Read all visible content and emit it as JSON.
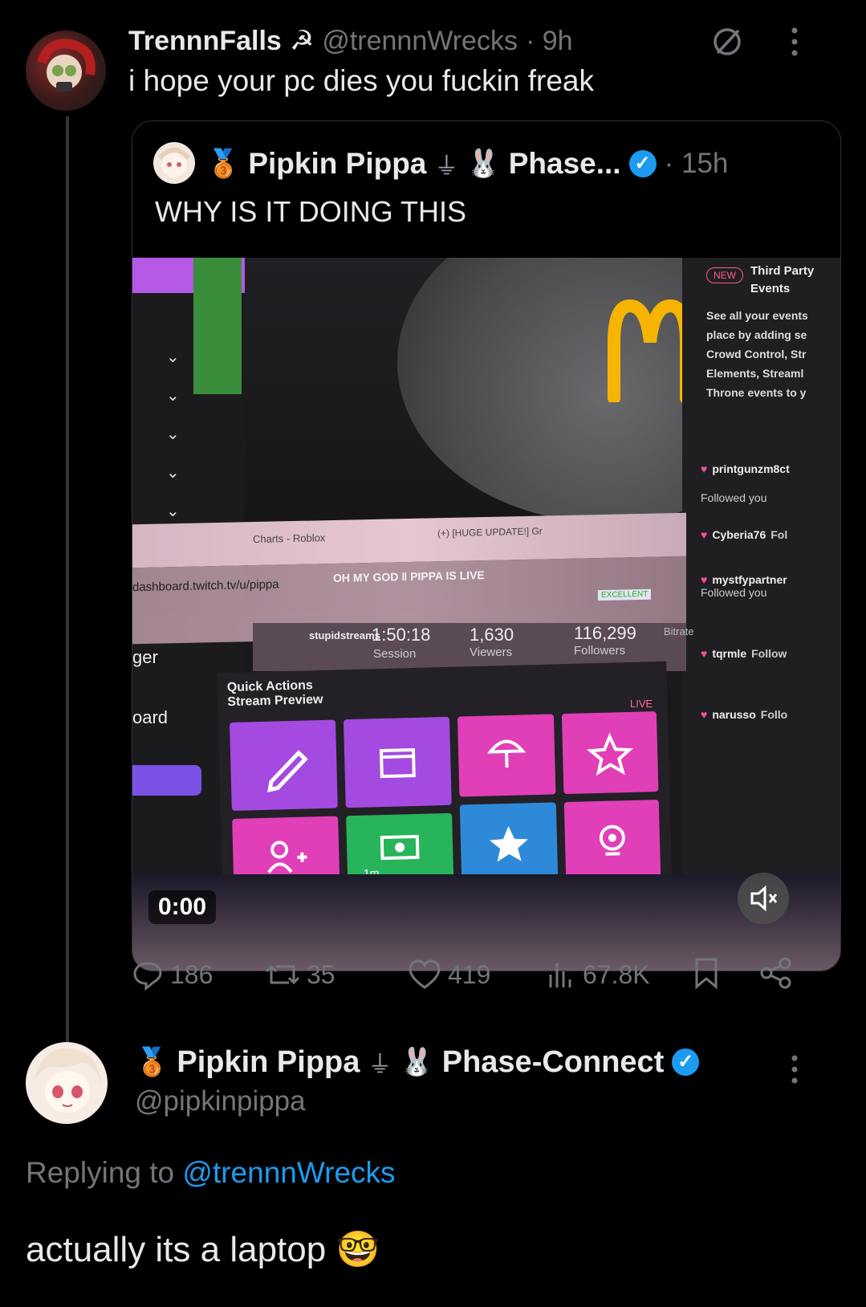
{
  "tweet": {
    "display_name": "TrennnFalls",
    "name_emoji": "☭",
    "handle": "@trennnWrecks",
    "time": "· 9h",
    "text": "i hope your pc dies you fuckin freak",
    "quote": {
      "display_name": "Pipkin Pippa",
      "name_suffix": "Phase...",
      "time": "· 15h",
      "text": "WHY IS IT DOING THIS",
      "video": {
        "timestamp": "0:00",
        "stream": {
          "url": "dashboard.twitch.tv/u/pippa",
          "live_title": "OH MY GOD ‖ PIPPA IS LIVE",
          "channel": "stupidstreams",
          "session_time": "1:50:18",
          "session_label": "Session",
          "viewers": "1,630",
          "viewers_label": "Viewers",
          "followers": "116,299",
          "followers_label": "Followers",
          "bitrate_label": "Bitrate",
          "quick_actions": "Quick Actions",
          "stream_preview": "Stream Preview",
          "excellent": "EXCELLENT",
          "live_badge": "LIVE",
          "tab1": "Charts - Roblox",
          "tab2": "(+) [HUGE UPDATE!] Gr",
          "third_party_title": "Third Party Events",
          "third_party_desc": "See all your events place by adding se Crowd Control, Str Elements, Streaml Throne events to y",
          "new_badge": "NEW",
          "feed": [
            {
              "name": "printgunzm8ct",
              "action": "Followed you"
            },
            {
              "name": "Cyberia76",
              "action": "Fol"
            },
            {
              "name": "mystfypartner",
              "action": "Followed you"
            },
            {
              "name": "tqrmle",
              "action": "Follow"
            },
            {
              "name": "narusso",
              "action": "Follo"
            }
          ],
          "tile_timer": "1m",
          "menu_label1": "ger",
          "menu_label2": "oard"
        }
      }
    },
    "metrics": {
      "replies": "186",
      "reposts": "35",
      "likes": "419",
      "views": "67.8K"
    }
  },
  "reply": {
    "display_name": "Pipkin Pippa",
    "name_suffix": "Phase-Connect",
    "handle": "@pipkinpippa",
    "replying_prefix": "Replying to",
    "replying_handle": "@trennnWrecks",
    "text": "actually its a laptop",
    "text_emoji": "🤓"
  },
  "colors": {
    "accent": "#1d9bf0",
    "muted": "#71767b",
    "tile_purple": "#a44ae0",
    "tile_magenta": "#e03fb8",
    "tile_green": "#27b45a",
    "tile_blue": "#2e8ad8",
    "mcdonalds_yellow": "#f5b500"
  }
}
